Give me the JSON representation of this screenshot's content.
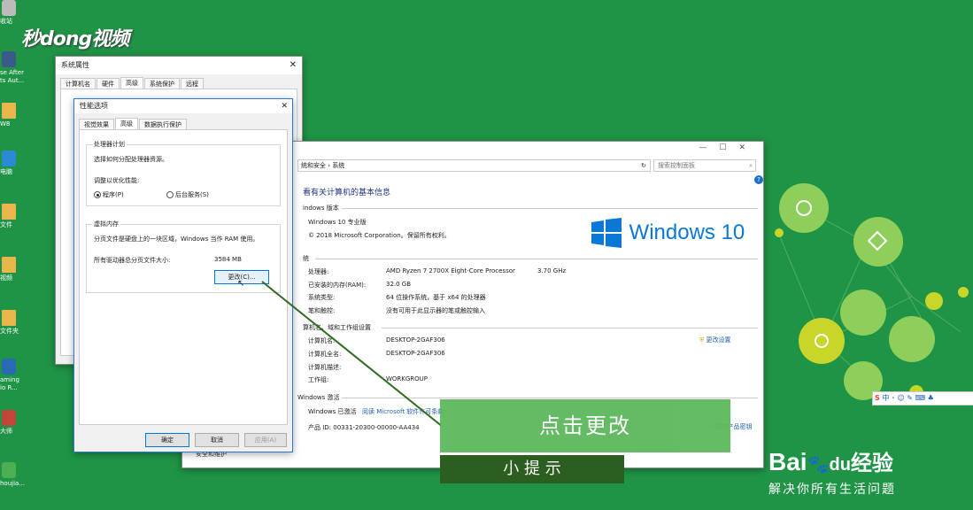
{
  "logo": {
    "text": "秒dong视频"
  },
  "desktop_icons": [
    {
      "label": "收站"
    },
    {
      "label": "se After\nts Aut..."
    },
    {
      "label": "W8"
    },
    {
      "label": "电脑"
    },
    {
      "label": "文件"
    },
    {
      "label": "视频"
    },
    {
      "label": "文件夹"
    },
    {
      "label": "aming\nio R..."
    },
    {
      "label": "大师"
    },
    {
      "label": "houjia..."
    }
  ],
  "sys_props": {
    "title": "系统属性",
    "tabs": [
      "计算机名",
      "硬件",
      "高级",
      "系统保护",
      "远程"
    ]
  },
  "perf": {
    "title": "性能选项",
    "tabs": [
      "视觉效果",
      "高级",
      "数据执行保护"
    ],
    "cpu_group": "处理器计划",
    "cpu_desc": "选择如何分配处理器资源。",
    "adjust_label": "调整以优化性能:",
    "radio_program": "程序(P)",
    "radio_service": "后台服务(S)",
    "vm_group": "虚拟内存",
    "vm_desc": "分页文件是硬盘上的一块区域，Windows 当作 RAM 使用。",
    "vm_total_label": "所有驱动器总分页文件大小:",
    "vm_total_value": "3584 MB",
    "change_button": "更改(C)...",
    "ok": "确定",
    "cancel": "取消",
    "apply": "应用(A)"
  },
  "system": {
    "breadcrumb": "统和安全  ›  系统",
    "search_placeholder": "搜索控制面板",
    "heading": "看有关计算机的基本信息",
    "edition_section": "indows 版本",
    "edition": "Windows 10 专业版",
    "copyright": "© 2018 Microsoft Corporation。保留所有权利。",
    "win10_logo": "Windows 10",
    "system_section": "统",
    "processor_label": "处理器:",
    "processor_value": "AMD Ryzen 7 2700X Eight-Core Processor",
    "processor_speed": "3.70 GHz",
    "ram_label": "已安装的内存(RAM):",
    "ram_value": "32.0 GB",
    "type_label": "系统类型:",
    "type_value": "64 位操作系统，基于 x64 的处理器",
    "pen_label": "笔和触控:",
    "pen_value": "没有可用于此显示器的笔或触控输入",
    "name_section": "算机名、域和工作组设置",
    "computer_name_label": "计算机名:",
    "computer_name_value": "DESKTOP-2GAF306",
    "full_name_label": "计算机全名:",
    "full_name_value": "DESKTOP-2GAF306",
    "desc_label": "计算机描述:",
    "workgroup_label": "工作组:",
    "workgroup_value": "WORKGROUP",
    "change_settings": "更改设置",
    "activation_section": "Windows 激活",
    "activated": "Windows 已激活",
    "read_terms": "阅读 Microsoft 软件许可条款",
    "product_id": "产品 ID: 00331-20300-00000-AA434",
    "change_key": "更改产品密钥",
    "security": "安全和维护"
  },
  "overlay": {
    "tip_main": "点击更改",
    "tip_sub": "小 提 示"
  },
  "ime": {
    "label": "中"
  },
  "watermark": {
    "brand_a": "Bai",
    "brand_b": "du",
    "brand_c": "经验",
    "slogan": "解决你所有生活问题"
  },
  "colors": {
    "desktop": "#1f9446",
    "tip_green": "#5cb85c",
    "tip_dark": "#2b5e1f",
    "win_blue": "#0078d7"
  }
}
